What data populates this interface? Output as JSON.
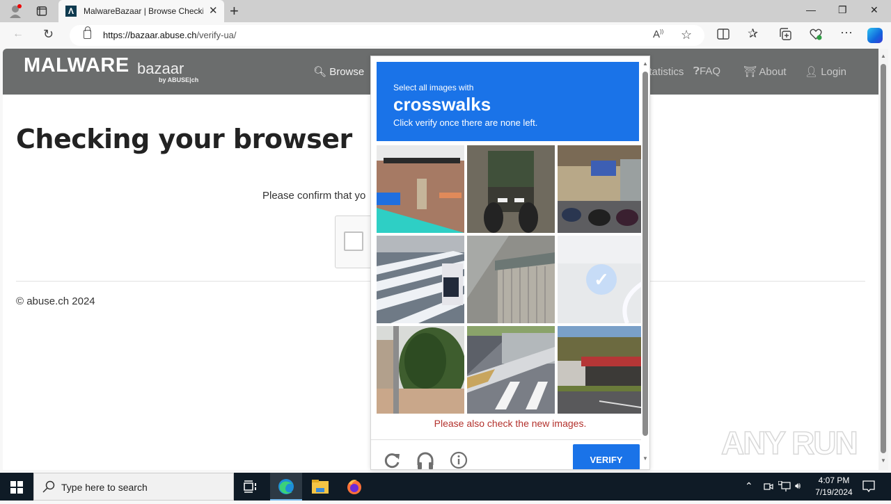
{
  "browser": {
    "tab": {
      "title": "MalwareBazaar | Browse Checking your browser",
      "favicon": "abuse-ch-logo-icon"
    },
    "new_tab_label": "+",
    "window_controls": {
      "minimize": "—",
      "restore": "❐",
      "close": "✕"
    },
    "address": {
      "url_domain": "https://bazaar.abuse.ch",
      "url_path": "/verify-ua/"
    },
    "toolbar_icons": [
      "read-aloud-icon",
      "favorite-star-icon",
      "split-screen-icon",
      "favorites-icon",
      "collections-icon",
      "browser-essentials-icon",
      "more-icon",
      "copilot-icon"
    ]
  },
  "site": {
    "logo": {
      "main": "MALWARE",
      "sub": "bazaar",
      "by": "by ABUSE|ch"
    },
    "nav": [
      {
        "label": "Browse",
        "icon": "search-icon"
      },
      {
        "label": "Statistics",
        "icon": "chart-icon"
      },
      {
        "label": "FAQ",
        "icon": "question-icon"
      },
      {
        "label": "About",
        "icon": "building-icon"
      },
      {
        "label": "Login",
        "icon": "user-icon"
      }
    ],
    "page_title": "Checking your browser",
    "confirm_text": "Please confirm that yo",
    "footer": "© abuse.ch 2024"
  },
  "captcha": {
    "instruction_line1": "Select all images with",
    "target": "crosswalks",
    "instruction_line3": "Click verify once there are none left.",
    "tiles": [
      {
        "desc": "bus stop with person",
        "selected": false
      },
      {
        "desc": "tractor",
        "selected": false
      },
      {
        "desc": "motorcycles on street",
        "selected": false
      },
      {
        "desc": "crosswalk with pedestrian",
        "selected": false
      },
      {
        "desc": "stairs and metal wall",
        "selected": false
      },
      {
        "desc": "road (fading)",
        "selected": true
      },
      {
        "desc": "bushes and wall",
        "selected": false
      },
      {
        "desc": "crosswalk near sidewalk",
        "selected": false
      },
      {
        "desc": "roadside building",
        "selected": false
      }
    ],
    "error_message": "Please also check the new images.",
    "verify_label": "VERIFY",
    "footer_icons": [
      "reload-icon",
      "audio-headphones-icon",
      "info-icon"
    ]
  },
  "watermark": "ANY RUN",
  "taskbar": {
    "search_placeholder": "Type here to search",
    "time": "4:07 PM",
    "date": "7/19/2024"
  }
}
